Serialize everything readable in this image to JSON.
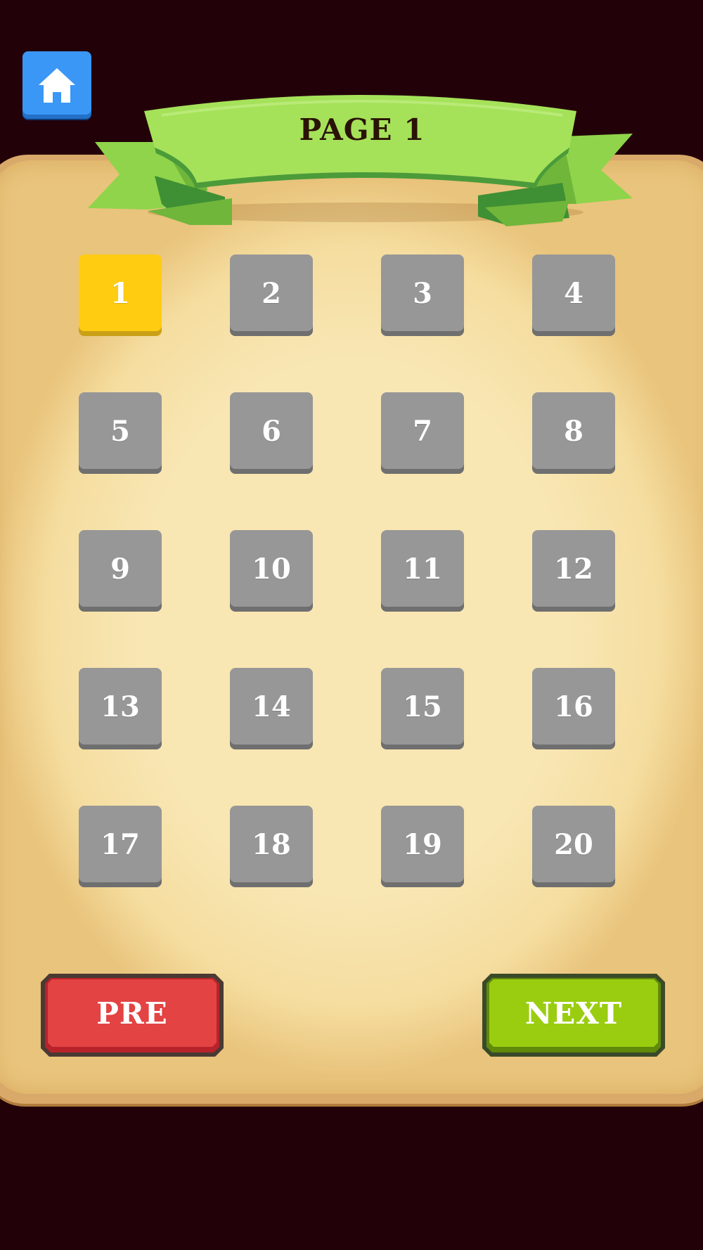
{
  "header": {
    "home_icon": "home-icon",
    "page_title": "PAGE 1"
  },
  "levels": {
    "current": 1,
    "items": [
      {
        "label": "1",
        "state": "current"
      },
      {
        "label": "2",
        "state": "locked"
      },
      {
        "label": "3",
        "state": "locked"
      },
      {
        "label": "4",
        "state": "locked"
      },
      {
        "label": "5",
        "state": "locked"
      },
      {
        "label": "6",
        "state": "locked"
      },
      {
        "label": "7",
        "state": "locked"
      },
      {
        "label": "8",
        "state": "locked"
      },
      {
        "label": "9",
        "state": "locked"
      },
      {
        "label": "10",
        "state": "locked"
      },
      {
        "label": "11",
        "state": "locked"
      },
      {
        "label": "12",
        "state": "locked"
      },
      {
        "label": "13",
        "state": "locked"
      },
      {
        "label": "14",
        "state": "locked"
      },
      {
        "label": "15",
        "state": "locked"
      },
      {
        "label": "16",
        "state": "locked"
      },
      {
        "label": "17",
        "state": "locked"
      },
      {
        "label": "18",
        "state": "locked"
      },
      {
        "label": "19",
        "state": "locked"
      },
      {
        "label": "20",
        "state": "locked"
      }
    ]
  },
  "navigation": {
    "prev_label": "PRE",
    "next_label": "NEXT"
  },
  "colors": {
    "background": "#230109",
    "home_button": "#3a97f6",
    "ribbon": "#a5e25a",
    "level_current": "#ffcc12",
    "level_locked": "#979797",
    "pre_button": "#e34343",
    "next_button": "#9acd10"
  }
}
